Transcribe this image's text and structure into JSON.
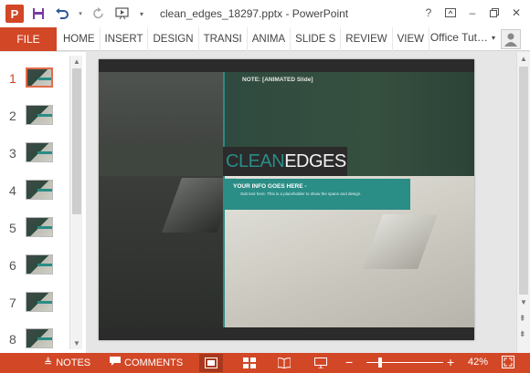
{
  "window": {
    "title": "clean_edges_18297.pptx - PowerPoint",
    "help": "?",
    "minimize": "–",
    "close": "✕",
    "app_letter": "P"
  },
  "ribbon": {
    "file": "FILE",
    "tabs": [
      "HOME",
      "INSERT",
      "DESIGN",
      "TRANSI",
      "ANIMA",
      "SLIDE S",
      "REVIEW",
      "VIEW"
    ],
    "account": "Office Tut…"
  },
  "thumbnails": {
    "selected": 1,
    "items": [
      "1",
      "2",
      "3",
      "4",
      "5",
      "6",
      "7",
      "8"
    ]
  },
  "slide": {
    "note": "NOTE: [ANIMATED Slide]",
    "title_part1": "CLEAN",
    "title_part2": "EDGES",
    "info_title": "YOUR INFO GOES HERE -",
    "info_sub": "Sub text here. This is a placeholder to show the space and design."
  },
  "statusbar": {
    "notes": "NOTES",
    "comments": "COMMENTS",
    "zoom": "42%",
    "zoom_fraction": 0.42
  },
  "colors": {
    "accent": "#d24726",
    "teal": "#2a8d86"
  }
}
